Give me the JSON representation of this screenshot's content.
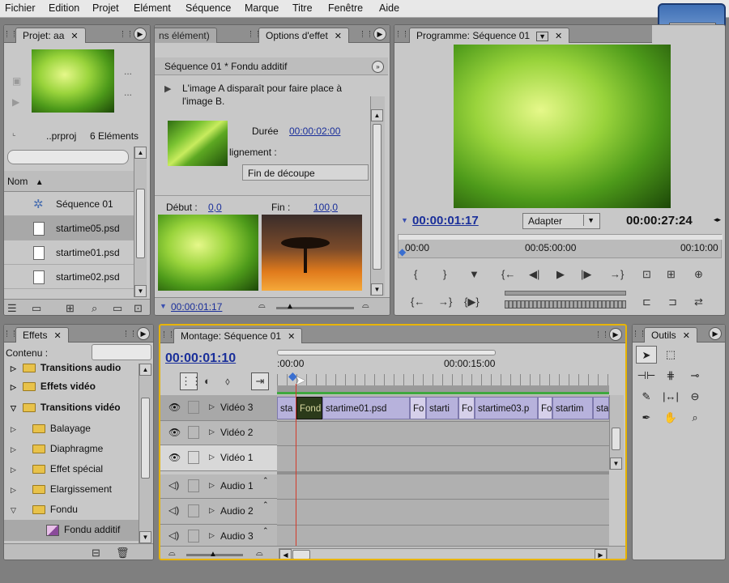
{
  "menu": [
    "Fichier",
    "Edition",
    "Projet",
    "Elément",
    "Séquence",
    "Marque",
    "Titre",
    "Fenêtre",
    "Aide"
  ],
  "project": {
    "tab": "Projet: aa",
    "filename": "..prproj",
    "count": "6 Eléments",
    "dots": "...",
    "column_name": "Nom",
    "items": [
      "Séquence 01",
      "startime05.psd",
      "startime01.psd",
      "startime02.psd"
    ]
  },
  "effect_options": {
    "tab_inactive": "ns élément)",
    "tab": "Options d'effet",
    "header": "Séquence 01 * Fondu additif",
    "description": "L'image A disparaît pour faire place à l'image B.",
    "duration_label": "Durée",
    "duration_value": "00:00:02:00",
    "alignment_label": "lignement :",
    "alignment_value": "Fin de découpe",
    "start_label": "Début :",
    "start_value": "0,0",
    "end_label": "Fin :",
    "end_value": "100,0",
    "timecode": "00:00:01:17"
  },
  "program": {
    "tab": "Programme: Séquence 01",
    "timecode": "00:00:01:17",
    "fit": "Adapter",
    "duration": "00:00:27:24",
    "ruler": [
      "00:00",
      "00:05:00:00",
      "00:10:00"
    ]
  },
  "effects": {
    "tab": "Effets",
    "content_label": "Contenu :",
    "items": [
      "Transitions audio",
      "Effets vidéo",
      "Transitions vidéo",
      "Balayage",
      "Diaphragme",
      "Effet spécial",
      "Elargissement",
      "Fondu",
      "Fondu additif"
    ]
  },
  "timeline": {
    "tab": "Montage: Séquence 01",
    "timecode": "00:00:01:10",
    "ruler": [
      ":00:00",
      "00:00:15:00"
    ],
    "tracks": [
      "Vidéo 3",
      "Vidéo 2",
      "Vidéo 1",
      "Audio 1",
      "Audio 2",
      "Audio 3"
    ],
    "clips": [
      "sta",
      "Fond",
      "startime01.psd",
      "Fo",
      "starti",
      "Fo",
      "startime03.p",
      "Fo",
      "startim",
      "sta"
    ]
  },
  "tools": {
    "tab": "Outils"
  },
  "colors": {
    "accent": "#e8b400",
    "timecode": "#1a2f9a",
    "clip": "#b7b2dc",
    "playhead": "#d43a2a"
  }
}
